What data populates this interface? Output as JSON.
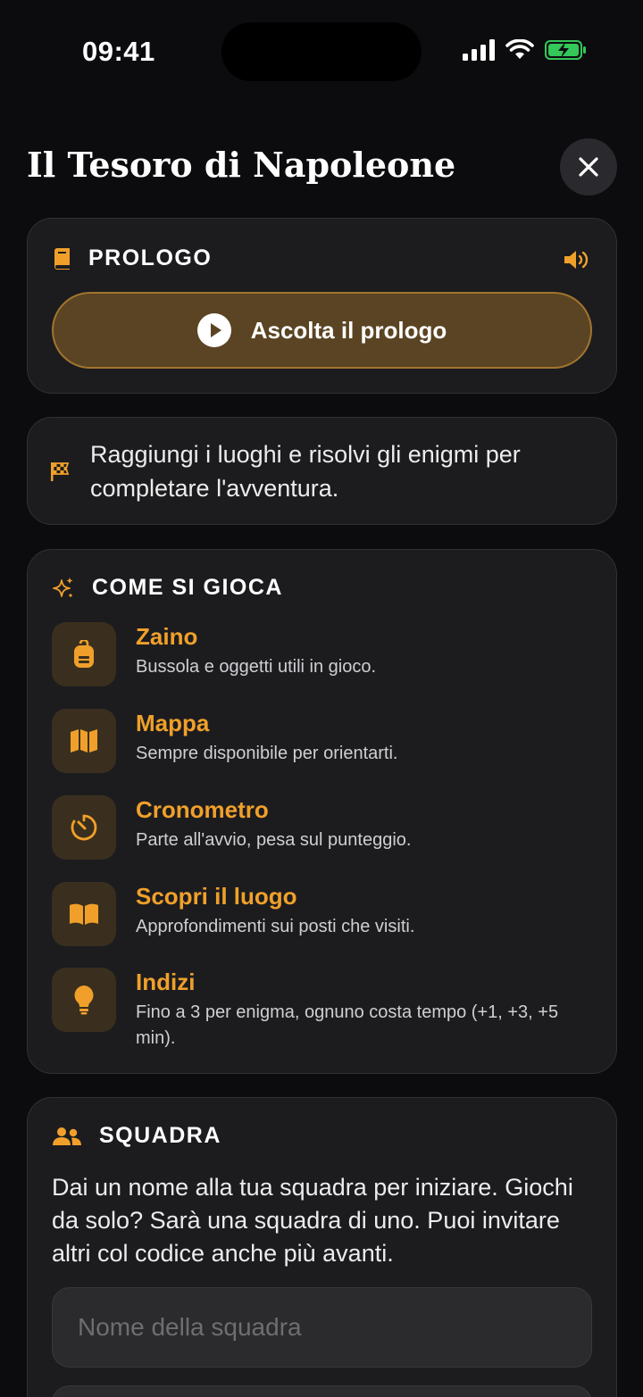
{
  "status": {
    "time": "09:41"
  },
  "header": {
    "title": "Il Tesoro di Napoleone"
  },
  "prologo": {
    "title": "PROLOGO",
    "play_label": "Ascolta il prologo"
  },
  "goal": {
    "text": "Raggiungi i luoghi e risolvi gli enigmi per completare l'avventura."
  },
  "howto": {
    "title": "COME SI GIOCA",
    "items": [
      {
        "title": "Zaino",
        "desc": "Bussola e oggetti utili in gioco.",
        "icon": "backpack-icon"
      },
      {
        "title": "Mappa",
        "desc": "Sempre disponibile per orientarti.",
        "icon": "map-icon"
      },
      {
        "title": "Cronometro",
        "desc": "Parte all'avvio, pesa sul punteggio.",
        "icon": "timer-icon"
      },
      {
        "title": "Scopri il luogo",
        "desc": "Approfondimenti sui posti che visiti.",
        "icon": "book-open-icon"
      },
      {
        "title": "Indizi",
        "desc": "Fino a 3 per enigma, ognuno costa tempo (+1, +3, +5 min).",
        "icon": "lightbulb-icon"
      }
    ]
  },
  "team": {
    "title": "SQUADRA",
    "desc": "Dai un nome alla tua squadra per iniziare. Giochi da solo? Sarà una squadra di uno. Puoi invitare altri col codice anche più avanti.",
    "input_placeholder": "Nome della squadra",
    "input_value": ""
  },
  "colors": {
    "accent": "#f0a02a",
    "background": "#0c0c0f",
    "card": "#1c1c1f",
    "icon_tile": "#3a2f1e",
    "play_button": "#5a4423",
    "battery": "#34c759"
  }
}
